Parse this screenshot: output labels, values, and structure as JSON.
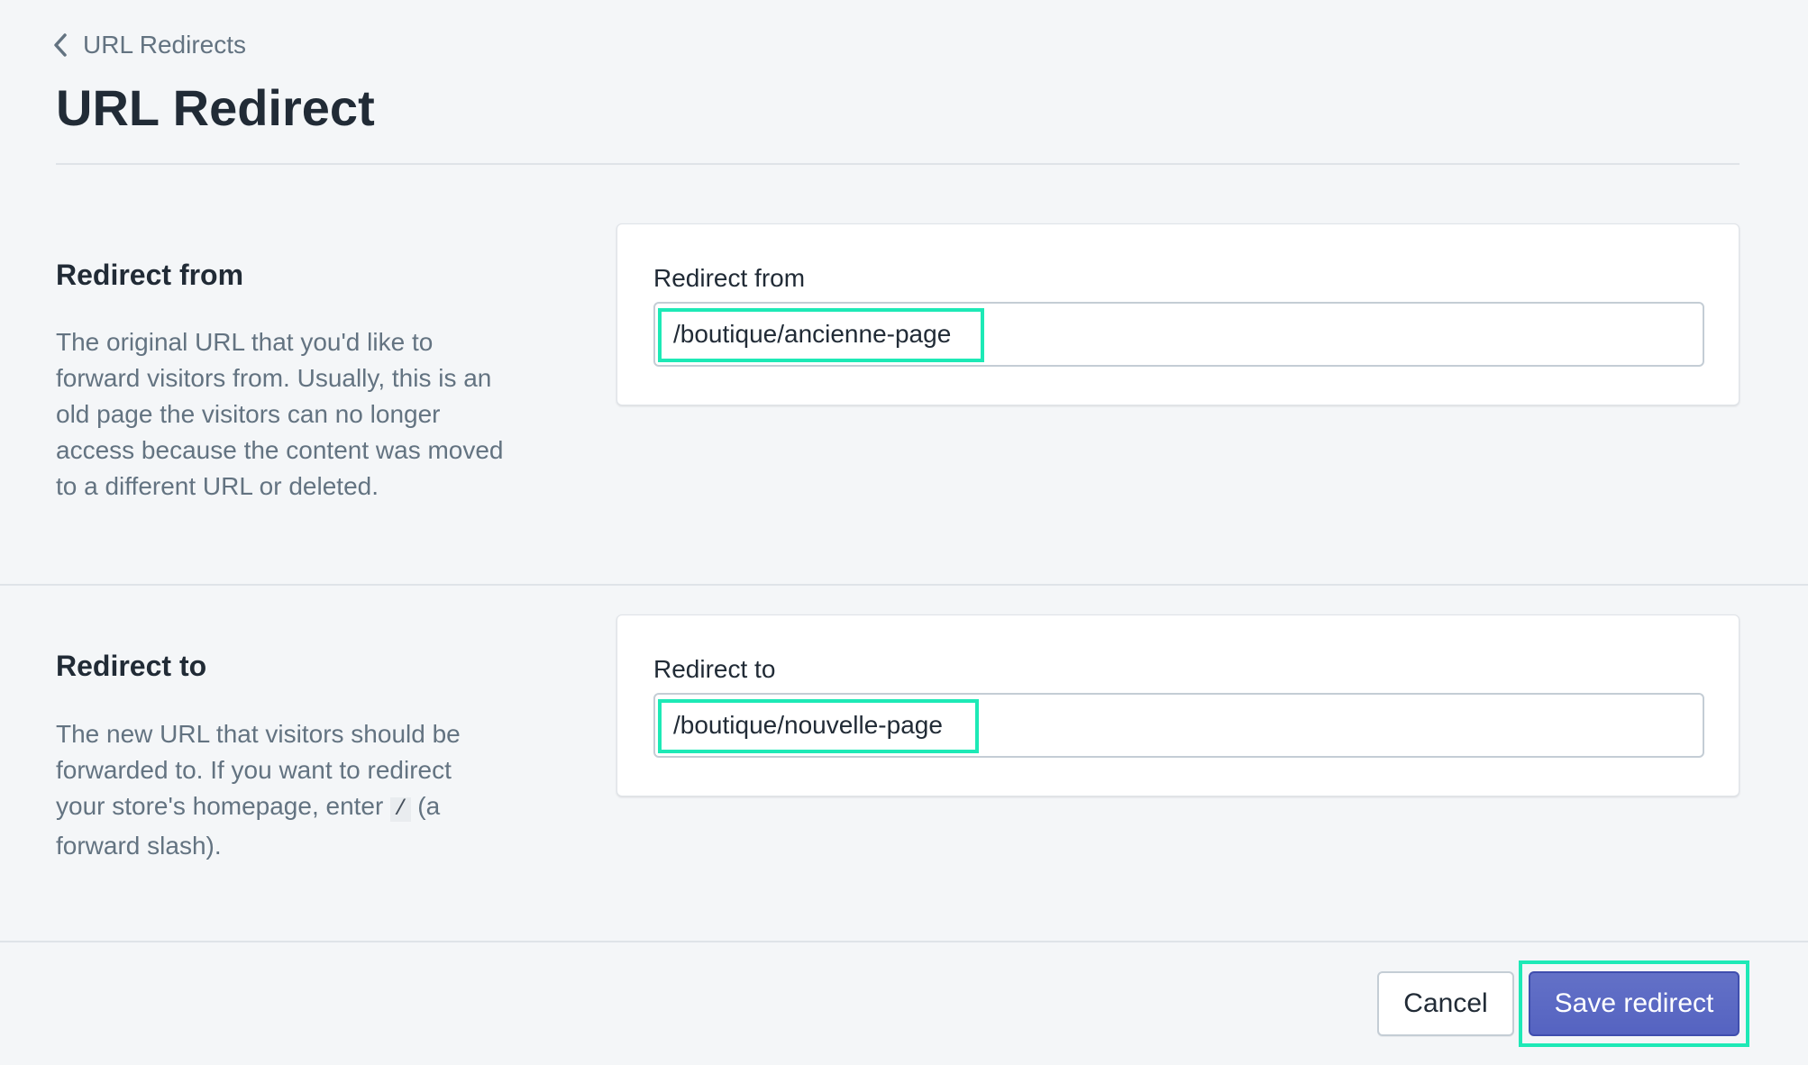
{
  "breadcrumb": {
    "label": "URL Redirects",
    "icon": "chevron-left-icon"
  },
  "page": {
    "title": "URL Redirect"
  },
  "sections": {
    "from": {
      "heading": "Redirect from",
      "description": "The original URL that you'd like to forward visitors from. Usually, this is an old page the visitors can no longer access because the content was moved to a different URL or deleted.",
      "field_label": "Redirect from",
      "field_value": "/boutique/ancienne-page"
    },
    "to": {
      "heading": "Redirect to",
      "description_before": "The new URL that visitors should be forwarded to. If you want to redirect your store's homepage, enter ",
      "description_code": "/",
      "description_after": " (a forward slash).",
      "field_label": "Redirect to",
      "field_value": "/boutique/nouvelle-page"
    }
  },
  "actions": {
    "cancel_label": "Cancel",
    "save_label": "Save redirect"
  },
  "colors": {
    "background": "#f4f6f8",
    "primary_button": "#5c6ac4",
    "highlight": "#1de9b6",
    "text_muted": "#637381"
  }
}
